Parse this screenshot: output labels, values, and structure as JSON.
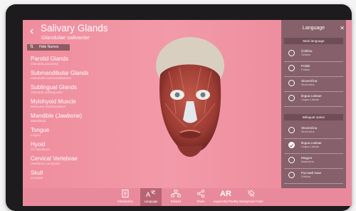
{
  "header": {
    "back_icon": "chevron-left-icon",
    "title": "Salivary Glands",
    "subtitle": "Glandulae salivariae",
    "hide_button_label": "Hide Names"
  },
  "structures": [
    {
      "name": "Parotid Glands",
      "latin": "Glandula parotidea"
    },
    {
      "name": "Submandibular Glands",
      "latin": "Glandulae submandibulares"
    },
    {
      "name": "Sublingual Glands",
      "latin": "Glandula sublinguales"
    },
    {
      "name": "Mylohyoid Muscle",
      "latin": "Musculus mylohyoideus"
    },
    {
      "name": "Mandible (Jawbone)",
      "latin": "Mandibula"
    },
    {
      "name": "Tongue",
      "latin": "Lingua"
    },
    {
      "name": "Hyoid",
      "latin": "Os hyoideum"
    },
    {
      "name": "Cervical Vertebrae",
      "latin": "Vertebrae cervicales"
    },
    {
      "name": "Skull",
      "latin": "Cranium"
    }
  ],
  "language_panel": {
    "title": "Language",
    "close_icon": "close-icon",
    "main_section": "Main language",
    "main_languages": [
      {
        "name": "Čeština",
        "native": "Čeština",
        "selected": false
      },
      {
        "name": "Polski",
        "native": "Polskie",
        "selected": false
      },
      {
        "name": "Slovenčina",
        "native": "Slovenčina",
        "selected": false
      },
      {
        "name": "lingua Latinae",
        "native": "Lingua Latinae",
        "selected": false
      }
    ],
    "bilingual_section": "Bilingual option",
    "bilingual_languages": [
      {
        "name": "Slovenčina",
        "native": "Slovenčina",
        "selected": false
      },
      {
        "name": "lingua Latinae",
        "native": "Lingua Latinae",
        "selected": true
      },
      {
        "name": "Magyar",
        "native": "Madarčina",
        "selected": false
      },
      {
        "name": "Русский язык",
        "native": "Ruština",
        "selected": false
      }
    ]
  },
  "toolbar": {
    "items": [
      {
        "label": "Introduction",
        "icon": "introduction-icon",
        "active": false
      },
      {
        "label": "Language",
        "icon": "language-icon",
        "active": true
      },
      {
        "label": "Related",
        "icon": "related-icon",
        "active": false
      },
      {
        "label": "Share",
        "icon": "share-icon",
        "active": false
      },
      {
        "label": "Augmented Reality",
        "icon": "ar-icon",
        "icon_text": "AR",
        "active": false
      },
      {
        "label": "Background Color",
        "icon": "background-color-icon",
        "active": false
      }
    ]
  },
  "colors": {
    "background": "#ef8d9d",
    "panel": "#86606a",
    "toolbar": "#e88a9b",
    "active_tab": "#b96474"
  }
}
